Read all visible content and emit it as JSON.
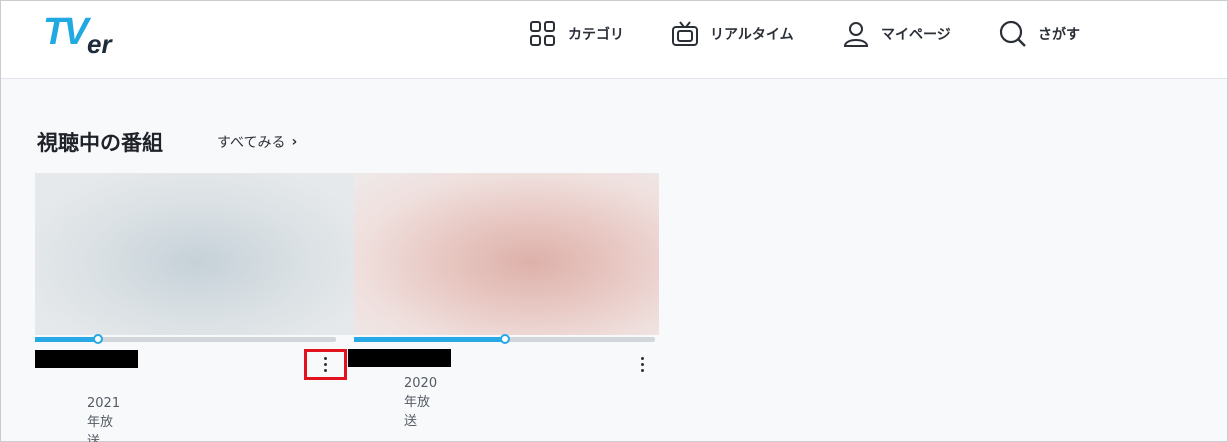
{
  "header": {
    "logo": "TVer",
    "nav": [
      {
        "label": "カテゴリ",
        "icon": "grid-icon"
      },
      {
        "label": "リアルタイム",
        "icon": "tv-icon"
      },
      {
        "label": "マイページ",
        "icon": "user-icon"
      },
      {
        "label": "さがす",
        "icon": "search-icon"
      }
    ]
  },
  "section": {
    "title": "視聴中の番組",
    "see_all": "すべてみる",
    "see_all_icon": "chevron-right-icon"
  },
  "cards": [
    {
      "air_date": "2021年放送",
      "progress": 0.21,
      "more_icon": "more-vertical-icon",
      "highlighted": true
    },
    {
      "air_date": "2020年放送",
      "progress": 0.5,
      "more_icon": "more-vertical-icon",
      "highlighted": false
    }
  ],
  "colors": {
    "brand": "#21a9e1",
    "progress": "#28a9e6",
    "highlight": "#e0131e"
  }
}
